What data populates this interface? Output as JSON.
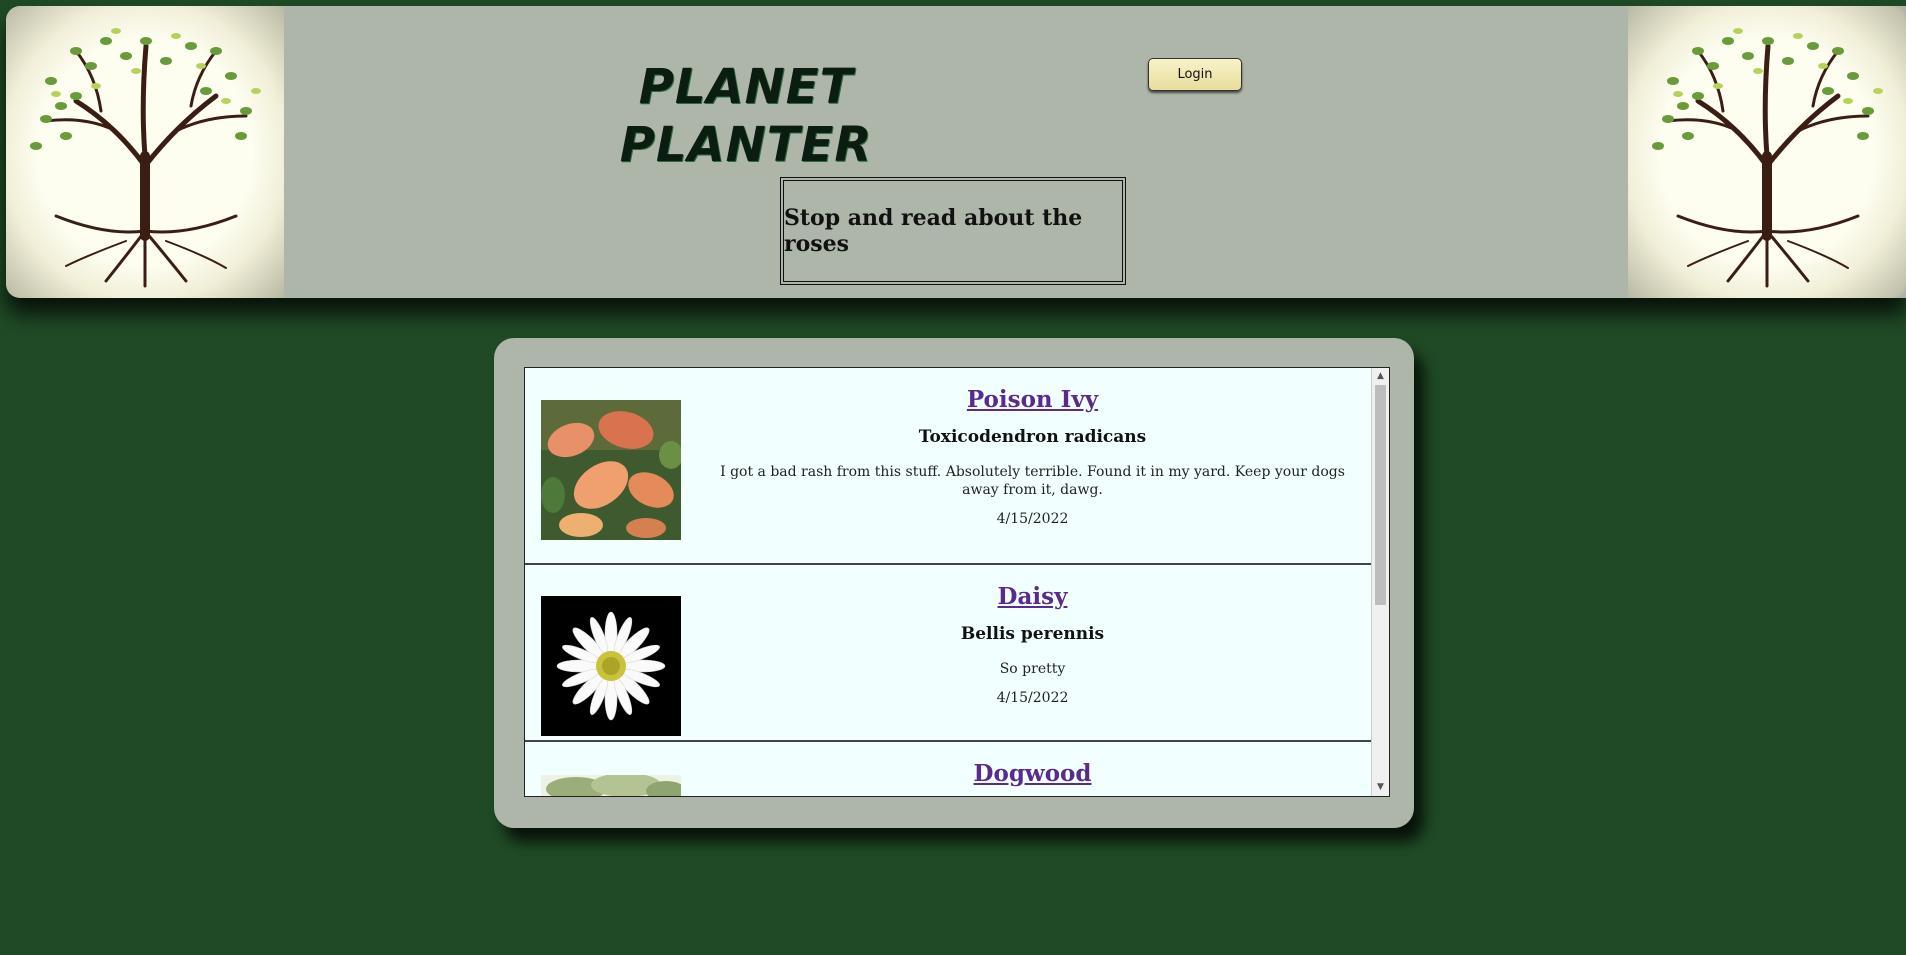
{
  "header": {
    "logo_line1": "PLANET",
    "logo_line2": "PLANTER",
    "login_label": "Login",
    "tagline": "Stop and read about the roses"
  },
  "posts": [
    {
      "name": "Poison Ivy",
      "scientific": "Toxicodendron radicans",
      "comment": "I got a bad rash from this stuff. Absolutely terrible. Found it in my yard. Keep your dogs away from it, dawg.",
      "date": "4/15/2022"
    },
    {
      "name": "Daisy",
      "scientific": "Bellis perennis",
      "comment": "So pretty",
      "date": "4/15/2022"
    },
    {
      "name": "Dogwood"
    }
  ],
  "scrollbar": {
    "up_icon": "chevron-up-icon",
    "down_icon": "chevron-down-icon"
  },
  "colors": {
    "page_background": "#1f4a25",
    "panel_background": "#aeb5a9",
    "card_background": "#f2ffff",
    "link": "#5a2a8c",
    "login_button": "#f3ecbf"
  }
}
